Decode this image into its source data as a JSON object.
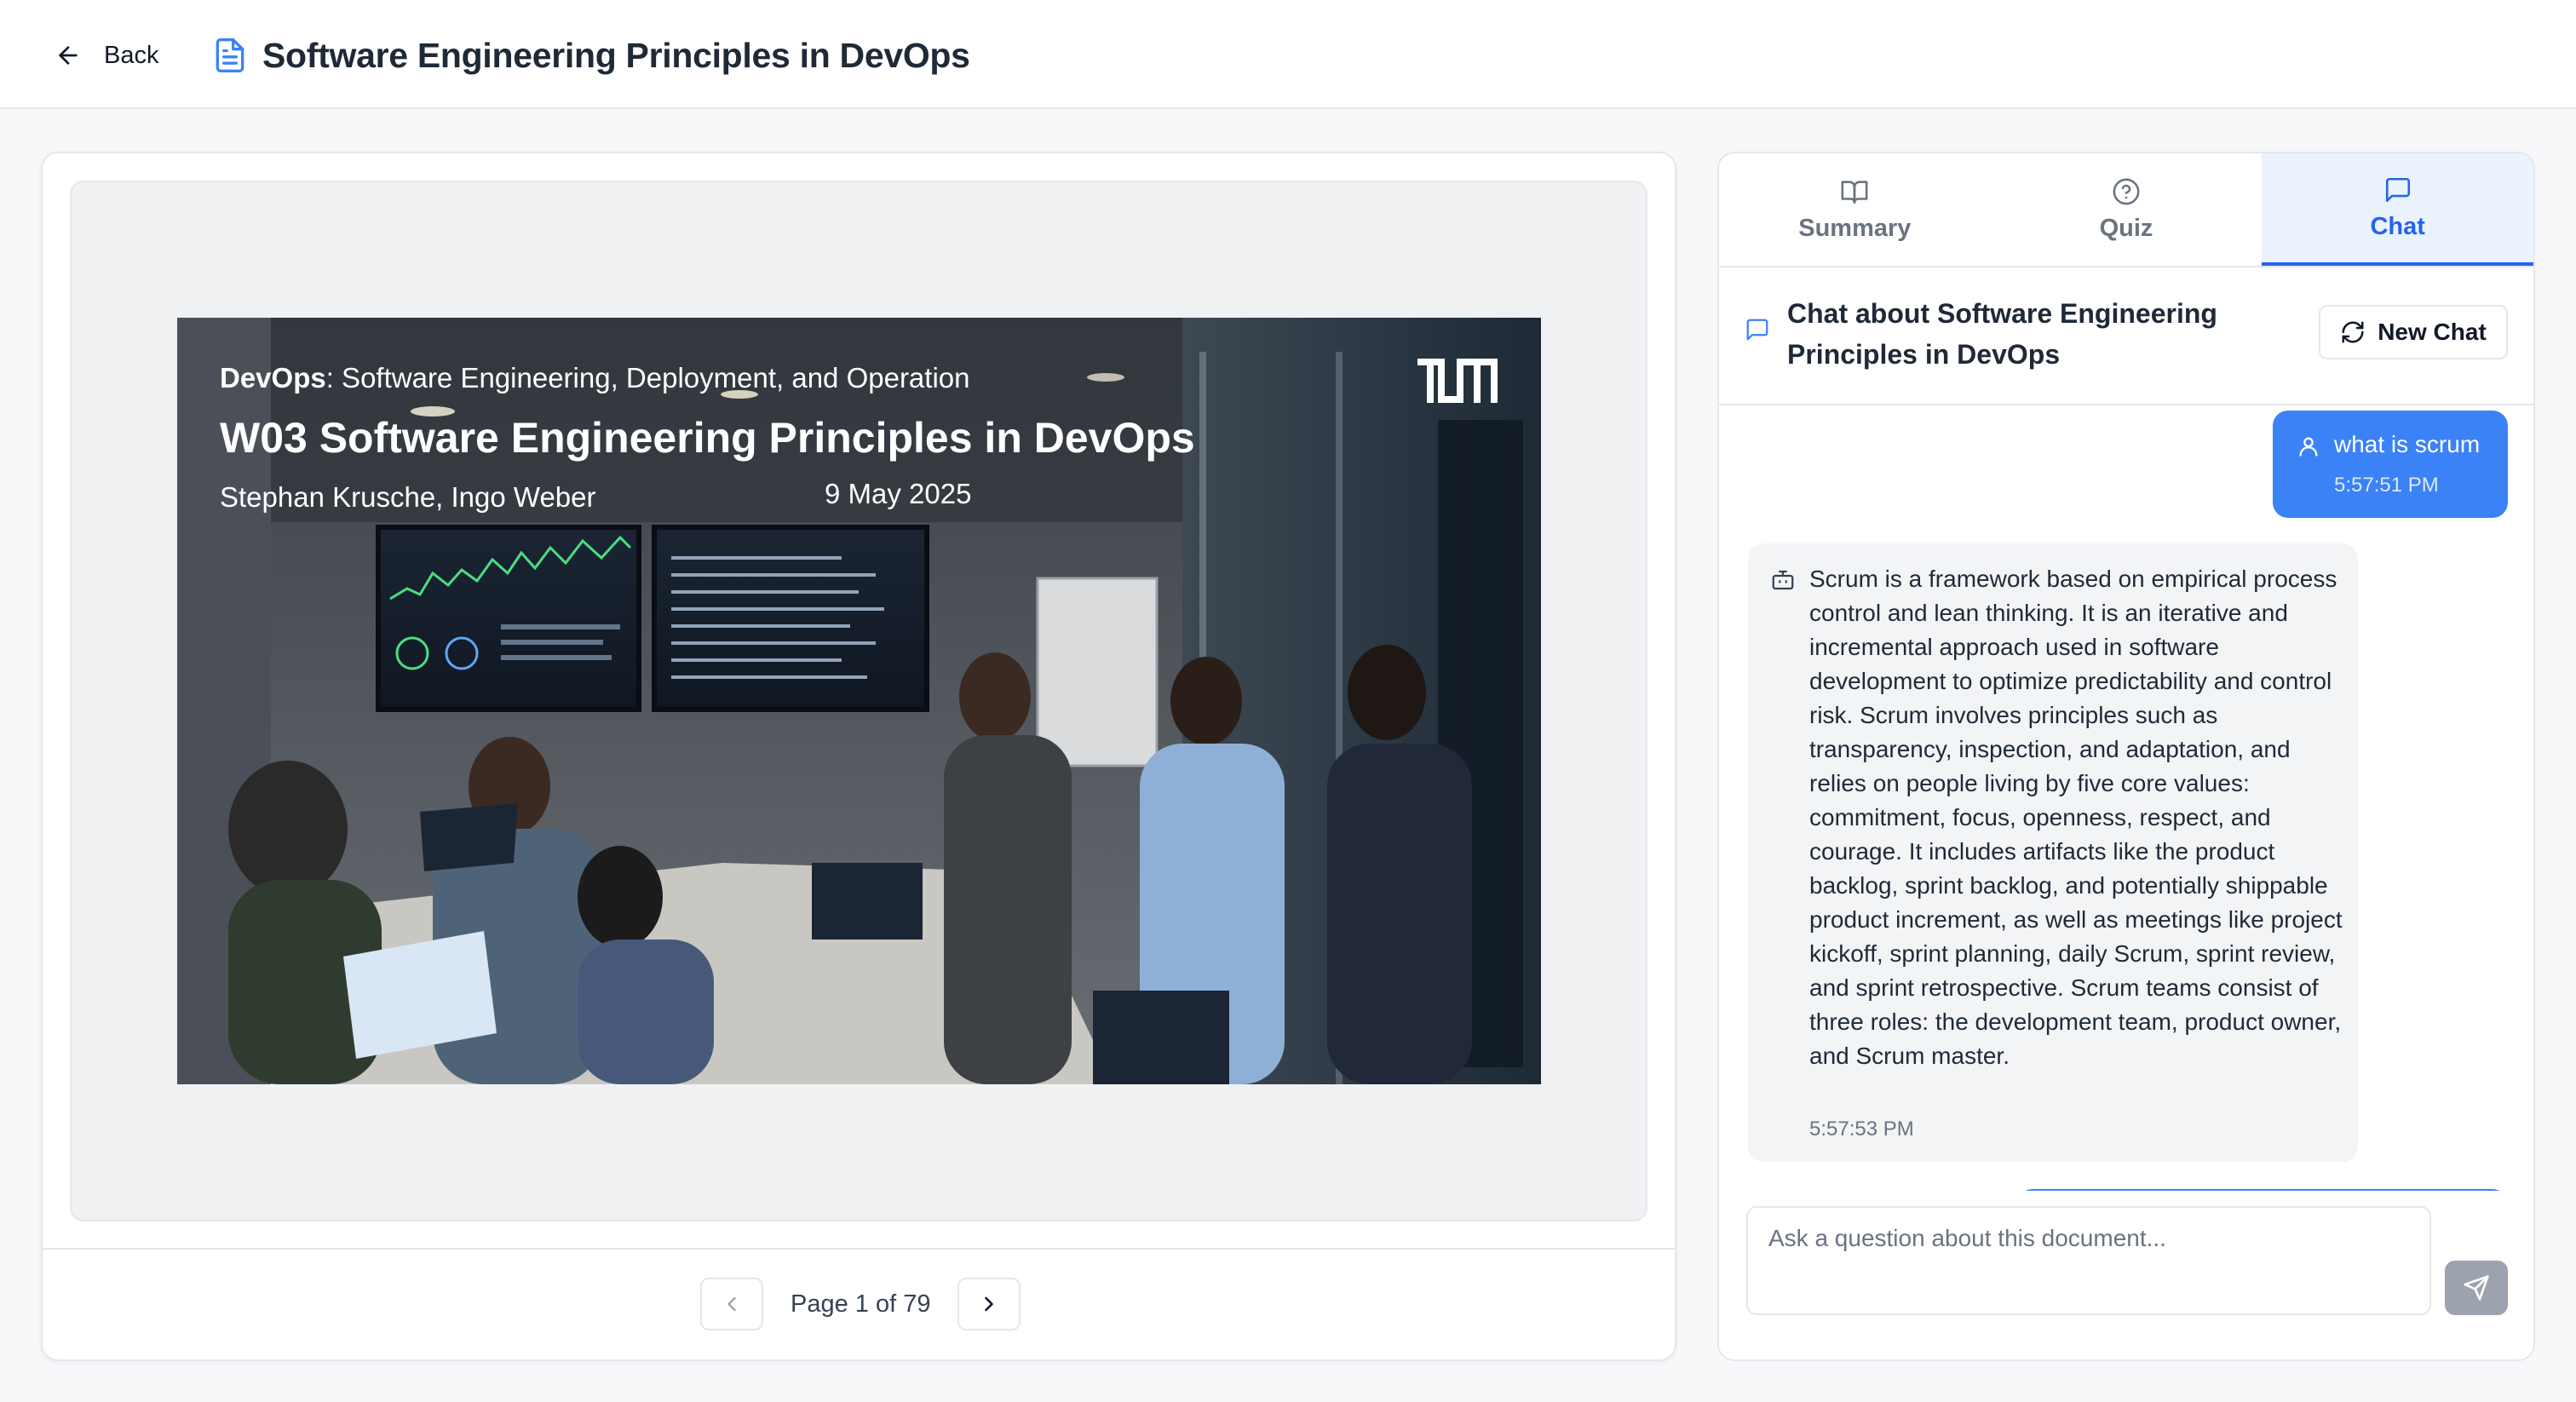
{
  "header": {
    "back_label": "Back",
    "title": "Software Engineering Principles in DevOps"
  },
  "viewer": {
    "slide": {
      "course_prefix": "DevOps",
      "course_rest": ": Software Engineering, Deployment, and Operation",
      "title": "W03 Software Engineering Principles in DevOps",
      "authors": "Stephan Krusche, Ingo Weber",
      "date": "9 May 2025"
    },
    "pager": {
      "text": "Page 1 of 79"
    }
  },
  "panel": {
    "tabs": [
      {
        "label": "Summary",
        "icon": "book-open-icon"
      },
      {
        "label": "Quiz",
        "icon": "help-circle-icon"
      },
      {
        "label": "Chat",
        "icon": "message-square-icon",
        "active": true
      }
    ],
    "chat_title": "Chat about Software Engineering Principles in DevOps",
    "new_chat_label": "New Chat",
    "messages": [
      {
        "role": "user",
        "text": "what is scrum",
        "time": "5:57:51 PM"
      },
      {
        "role": "assistant",
        "text": "Scrum is a framework based on empirical process control and lean thinking. It is an iterative and incremental approach used in software development to optimize predictability and control risk. Scrum involves principles such as transparency, inspection, and adaptation, and relies on people living by five core values: commitment, focus, openness, respect, and courage. It includes artifacts like the product backlog, sprint backlog, and potentially shippable product increment, as well as meetings like project kickoff, sprint planning, daily Scrum, sprint review, and sprint retrospective. Scrum teams consist of three roles: the development team, product owner, and Scrum master.",
        "time": "5:57:53 PM"
      }
    ],
    "composer": {
      "placeholder": "Ask a question about this document...",
      "value": ""
    }
  },
  "colors": {
    "accent": "#3b82f6",
    "accent_dark": "#2563eb",
    "active_tab_bg": "#eaf2fd",
    "send_disabled": "#9ca3af"
  }
}
